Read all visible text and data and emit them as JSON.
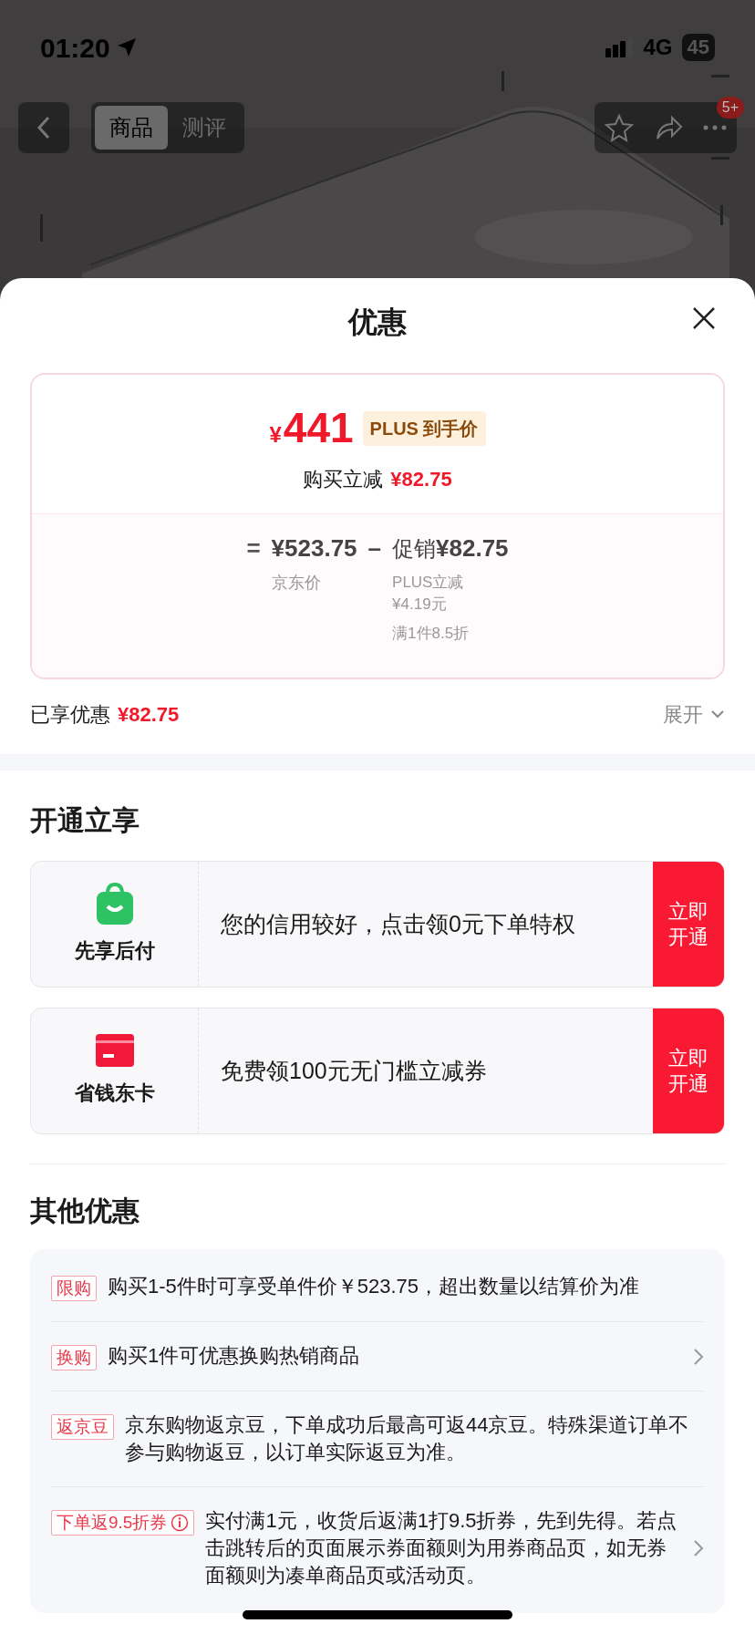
{
  "status_bar": {
    "time": "01:20",
    "network": "4G",
    "battery": "45"
  },
  "nav": {
    "tabs": [
      {
        "label": "商品",
        "selected": true
      },
      {
        "label": "测评",
        "selected": false
      }
    ],
    "badge": "5+"
  },
  "sheet": {
    "title": "优惠"
  },
  "price_card": {
    "currency": "¥",
    "price": "441",
    "price_tag": "PLUS 到手价",
    "discount_label": "购买立减",
    "discount_amount": "¥82.75",
    "equals": "=",
    "base_price": "¥523.75",
    "base_label": "京东价",
    "minus": "–",
    "promo_label": "促销",
    "promo_amount": "¥82.75",
    "promo_details": [
      "PLUS立减¥4.19元",
      "满1件8.5折"
    ]
  },
  "saved": {
    "label": "已享优惠",
    "amount": "¥82.75",
    "expand": "展开"
  },
  "open_section": {
    "title": "开通立享",
    "cards": [
      {
        "kind": "bag",
        "name": "先享后付",
        "text": "您的信用较好，点击领0元下单特权",
        "button": "立即开通"
      },
      {
        "kind": "card",
        "name": "省钱东卡",
        "text": "免费领100元无门槛立减券",
        "button": "立即开通"
      }
    ]
  },
  "other_section": {
    "title": "其他优惠",
    "items": [
      {
        "tag": "限购",
        "info": false,
        "text": "购买1-5件时可享受单件价￥523.75，超出数量以结算价为准",
        "chevron": false
      },
      {
        "tag": "换购",
        "info": false,
        "text": "购买1件可优惠换购热销商品",
        "chevron": true
      },
      {
        "tag": "返京豆",
        "info": false,
        "text": "京东购物返京豆，下单成功后最高可返44京豆。特殊渠道订单不参与购物返豆，以订单实际返豆为准。",
        "chevron": false
      },
      {
        "tag": "下单返9.5折券",
        "info": true,
        "text": "实付满1元，收货后返满1打9.5折券，先到先得。若点击跳转后的页面展示券面额则为用券商品页，如无券面额则为凑单商品页或活动页。",
        "chevron": true
      }
    ]
  }
}
